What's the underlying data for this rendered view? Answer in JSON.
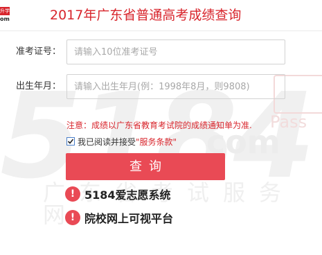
{
  "logo": {
    "badge_text": "升学",
    "site_text": "om"
  },
  "watermark": {
    "number": "5184",
    "domain": "com",
    "pass": "Pass",
    "chars": "广东省考试服务网"
  },
  "header": {
    "title": "2017年广东省普通高考成绩查询"
  },
  "form": {
    "ticket_label": "准考证号：",
    "ticket_placeholder": "请输入10位准考证号",
    "birth_label": "出生年月：",
    "birth_placeholder": "请输入出生年月(例：1998年8月，则9808)"
  },
  "notice": "注意：成绩以广东省教育考试院的成绩通知单为准.",
  "agreement": {
    "checked": true,
    "text": "我已阅读并接受",
    "link": "\"服务条款\""
  },
  "submit_label": "查询",
  "systems": [
    "5184爱志愿系统",
    "院校网上可视平台"
  ],
  "colors": {
    "accent_red": "#d8252c",
    "button_red": "#e94a55",
    "checkbox_blue": "#4a7fc9"
  }
}
